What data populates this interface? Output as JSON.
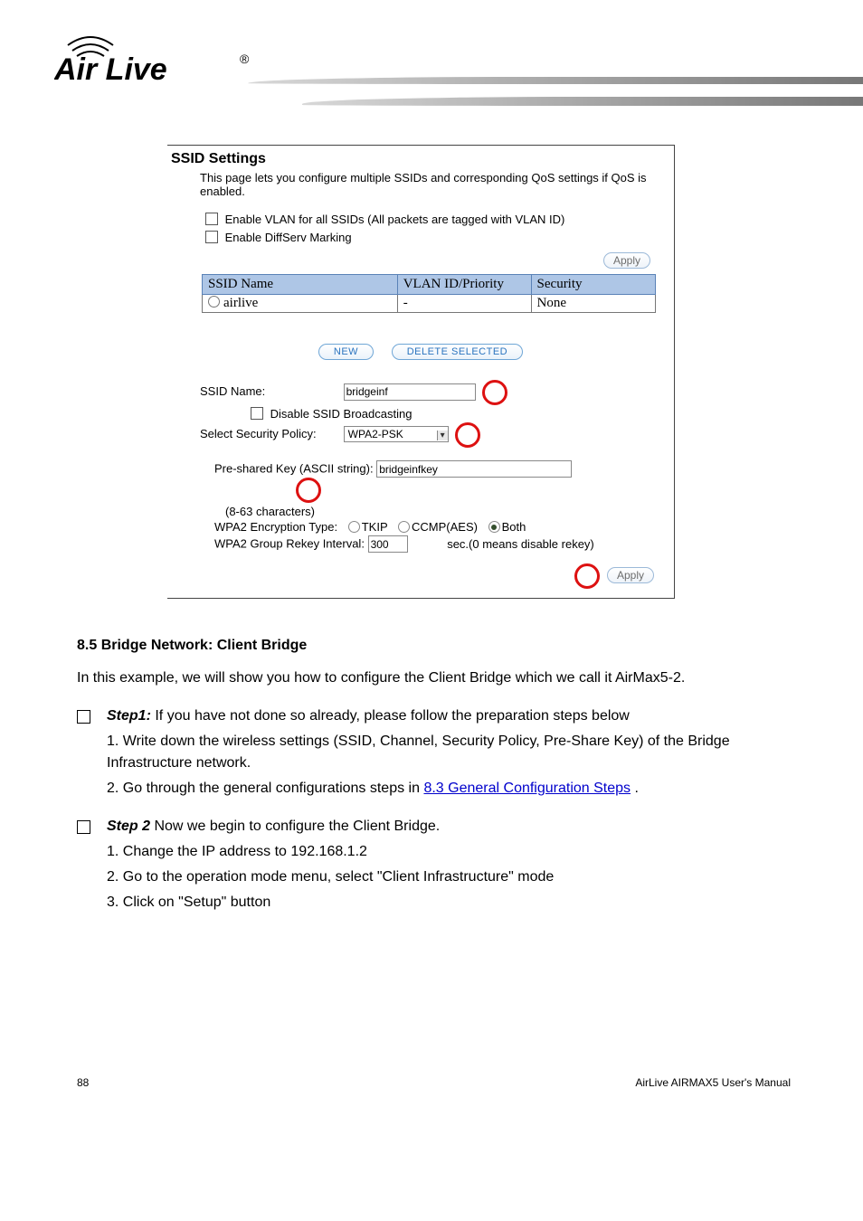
{
  "logo": {
    "brand": "Air Live"
  },
  "panel": {
    "title": "SSID Settings",
    "description": "This page lets you configure multiple SSIDs and corresponding QoS settings if QoS is enabled.",
    "check_vlan": "Enable VLAN for all SSIDs (All packets are tagged with VLAN ID)",
    "check_diffserv": "Enable DiffServ Marking",
    "apply": "Apply",
    "table": {
      "h1": "SSID  Name",
      "h2": "VLAN ID/Priority",
      "h3": "Security",
      "row": {
        "name": "airlive",
        "vlan": "-",
        "sec": "None"
      }
    },
    "btn_new": "NEW",
    "btn_del": "DELETE SELECTED",
    "form": {
      "ssid_lbl": "SSID Name:",
      "ssid_val": "bridgeinf",
      "disable_bcast": "Disable SSID Broadcasting",
      "policy_lbl": "Select Security Policy:",
      "policy_val": "WPA2-PSK",
      "psk_lbl": "Pre-shared Key (ASCII string):",
      "psk_val": "bridgeinfkey",
      "psk_hint": "(8-63 characters)",
      "enc_lbl": "WPA2 Encryption Type:",
      "enc_tkip": "TKIP",
      "enc_ccmp": "CCMP(AES)",
      "enc_both": "Both",
      "rekey_lbl": "WPA2 Group Rekey Interval:",
      "rekey_val": "300",
      "rekey_hint": "sec.(0 means disable rekey)"
    }
  },
  "body": {
    "sec_num": "8.5",
    "sec_title": "Bridge Network: Client Bridge",
    "intro": "In this example, we will show you how to configure the Client Bridge which we call it AirMax5-2.",
    "step1_hdr": "Step1:",
    "step1_txt": "If you have not done so already, please follow the preparation steps below",
    "step1_a": "1. Write down the wireless settings (SSID, Channel, Security Policy, Pre-Share Key) of the Bridge Infrastructure network.",
    "step1_b_a": "2. Go through the general configurations steps in ",
    "step1_b_link": "8.3 General Configuration Steps",
    "step1_b_c": ".",
    "step2_hdr": "Step 2",
    "step2_txt": "Now we begin to configure the Client Bridge.",
    "step2_a": "1. Change the IP address to 192.168.1.2",
    "step2_b": "2. Go to the operation mode menu, select \"Client Infrastructure\" mode",
    "step2_c": "3. Click on \"Setup\" button"
  },
  "footer": {
    "page": "88",
    "tag": "AirLive AIRMAX5 User's Manual"
  }
}
